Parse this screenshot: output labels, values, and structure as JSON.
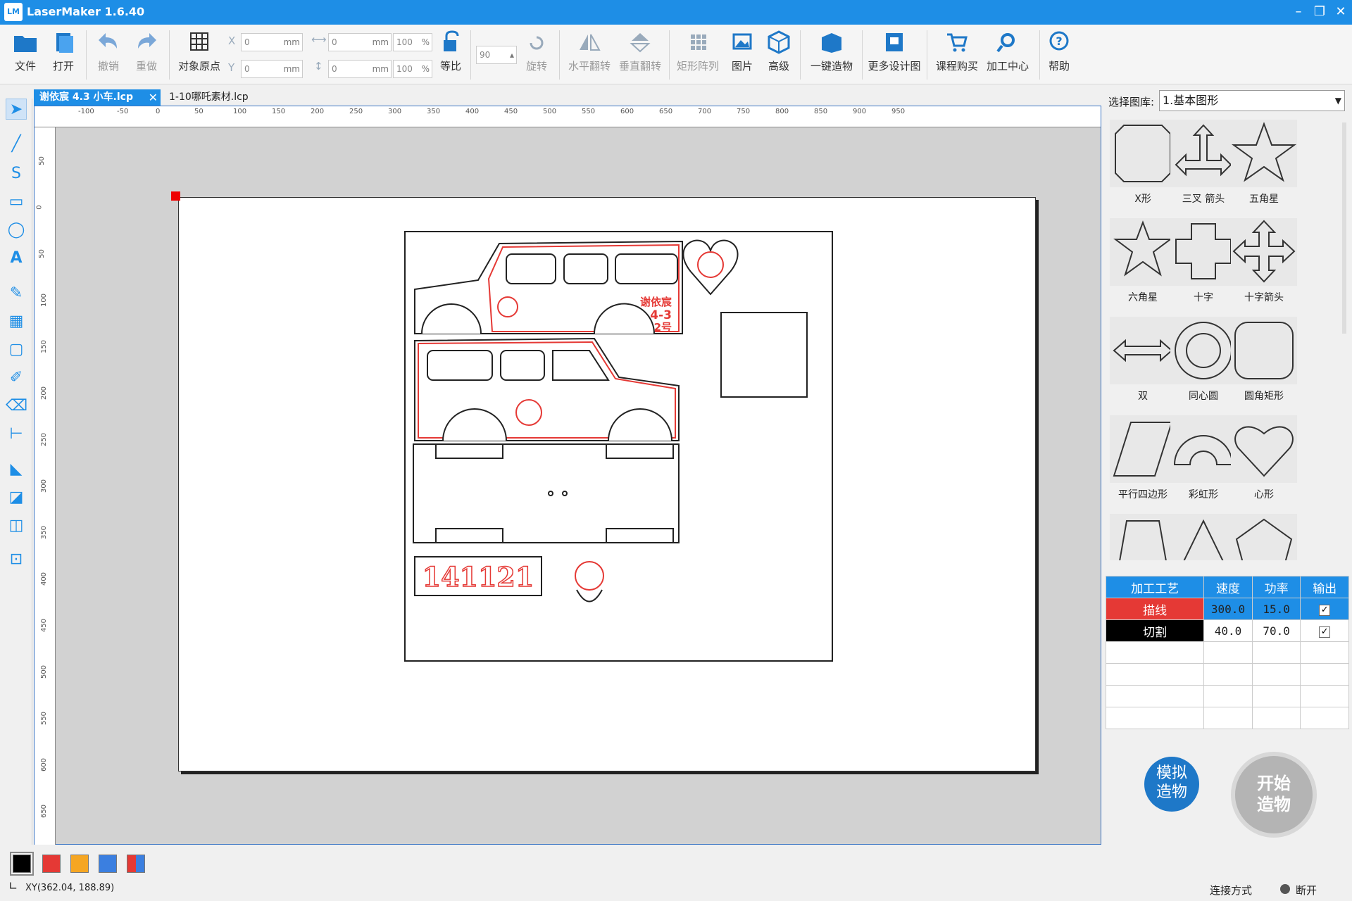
{
  "app": {
    "title": "LaserMaker 1.6.40",
    "logo_text": "LM"
  },
  "toolbar": {
    "file": "文件",
    "open": "打开",
    "undo": "撤销",
    "redo": "重做",
    "object_origin": "对象原点",
    "x_label": "X",
    "y_label": "Y",
    "x_value": "0",
    "y_value": "0",
    "w_value": "0",
    "h_value": "0",
    "w_pct": "100",
    "h_pct": "100",
    "unit_mm": "mm",
    "unit_pct": "%",
    "ratio": "等比",
    "rotate_value": "90",
    "rotate": "旋转",
    "flip_h": "水平翻转",
    "flip_v": "垂直翻转",
    "array": "矩形阵列",
    "image": "图片",
    "advanced": "高级",
    "one_click": "一键造物",
    "more_designs": "更多设计图",
    "course": "课程购买",
    "process_center": "加工中心",
    "help": "帮助"
  },
  "tabs": [
    {
      "label": "谢依宸 4.3 小车.lcp",
      "active": true
    },
    {
      "label": "1-10哪吒素材.lcp",
      "active": false
    }
  ],
  "ruler": {
    "h": [
      "-100",
      "-50",
      "0",
      "50",
      "100",
      "150",
      "200",
      "250",
      "300",
      "350",
      "400",
      "450",
      "500",
      "550",
      "600",
      "650",
      "700",
      "750",
      "800",
      "850",
      "900",
      "950"
    ],
    "v": [
      "50",
      "0",
      "50",
      "100",
      "150",
      "200",
      "250",
      "300",
      "350",
      "400",
      "450",
      "500",
      "550",
      "600",
      "650"
    ]
  },
  "canvas": {
    "plate_text": "141121",
    "car_text_name": "谢依宸",
    "car_text_date": "4-3",
    "car_text_no": "2号"
  },
  "library": {
    "label": "选择图库:",
    "selected": "1.基本图形",
    "shapes": [
      "X形",
      "三叉 箭头",
      "五角星",
      "六角星",
      "十字",
      "十字箭头",
      "双",
      "同心圆",
      "圆角矩形",
      "平行四边形",
      "彩虹形",
      "心形",
      "",
      "",
      ""
    ]
  },
  "process": {
    "headers": [
      "加工工艺",
      "速度",
      "功率",
      "输出"
    ],
    "rows": [
      {
        "name": "描线",
        "speed": "300.0",
        "power": "15.0",
        "output": "✓",
        "color": "#e53935"
      },
      {
        "name": "切割",
        "speed": "40.0",
        "power": "70.0",
        "output": "✓",
        "color": "#000000"
      }
    ]
  },
  "actions": {
    "simulate": "模拟造物",
    "start": "开始造物"
  },
  "palette": [
    "#000000",
    "#e53935",
    "#f5a623",
    "#3b7fe0",
    "multi"
  ],
  "status": {
    "coords": "XY(362.04, 188.89)",
    "connection_label": "连接方式",
    "connection_state": "断开"
  },
  "colors": {
    "accent": "#1e8ee6",
    "line_red": "#e53935"
  }
}
